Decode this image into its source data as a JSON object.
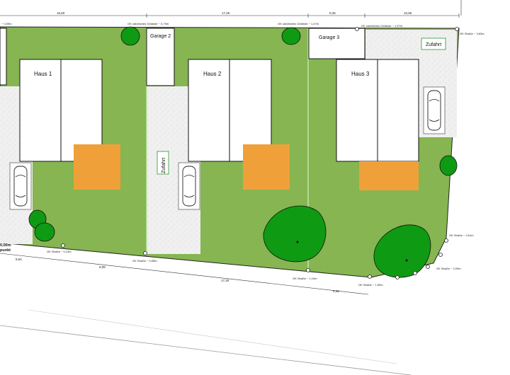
{
  "houses": [
    {
      "label": "Haus 1"
    },
    {
      "label": "Haus 2"
    },
    {
      "label": "Haus 3"
    }
  ],
  "garages": [
    {
      "label": "Garage 2"
    },
    {
      "label": "Garage 3"
    }
  ],
  "driveways": [
    {
      "label": "Zufahrt"
    },
    {
      "label": "Zufahrt"
    }
  ],
  "elevation_notes": {
    "top": [
      "OK natürliches Gelände ~ 0,79m",
      "OK natürliches Gelände ~ 1,47m",
      "OK natürliches Gelände ~ 1,57m"
    ],
    "top_left": "~ 0,09m",
    "right_top": "OK Straße ~ 3,63m",
    "right_mid": "OK Straße ~ 2,61m",
    "right_low": "OK Straße ~ 2,09m",
    "bottom": [
      "OK Straße ~ 0,13m",
      "OK Straße ~ 0,08m",
      "OK Straße ~ 1,19m",
      "OK Straße ~ 1,59m"
    ]
  },
  "reference": {
    "value": "0,00m",
    "label": "punkt"
  },
  "dimensions": {
    "top": [
      "16,60",
      "17,25",
      "8,35",
      "10,65"
    ],
    "bottom": [
      "8,64",
      "9,08",
      "17,25",
      "9,32"
    ]
  },
  "colors": {
    "lawn": "#86b552",
    "terrace": "#f0a038",
    "tree": "#0f9a14",
    "paving": "#efefef",
    "building": "#ffffff"
  }
}
